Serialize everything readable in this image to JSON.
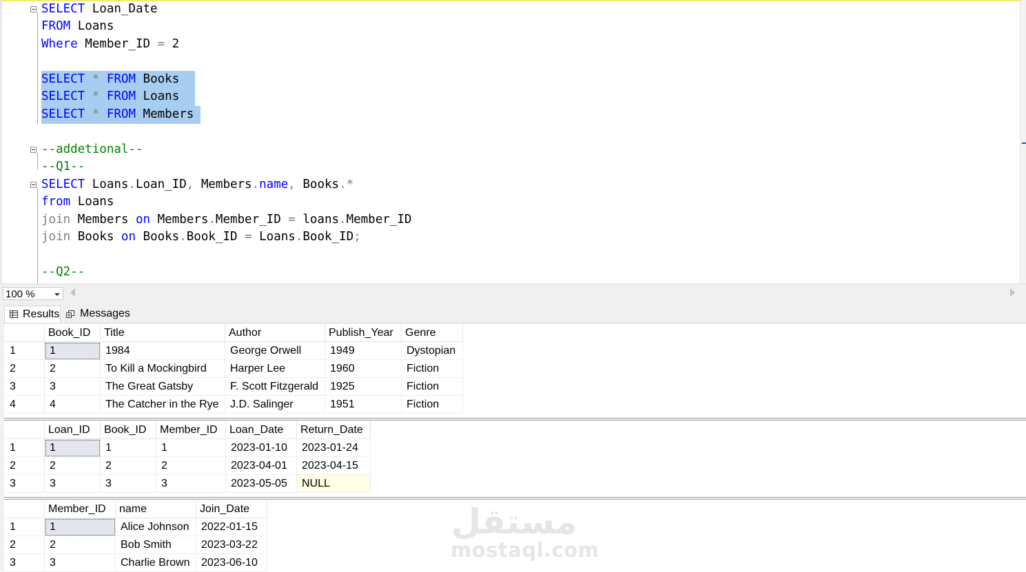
{
  "editor": {
    "lines": [
      {
        "tokens": [
          {
            "t": "SELECT",
            "c": "kw"
          },
          {
            "t": " Loan_Date",
            "c": ""
          }
        ]
      },
      {
        "tokens": [
          {
            "t": "FROM",
            "c": "kw"
          },
          {
            "t": " Loans",
            "c": ""
          }
        ]
      },
      {
        "tokens": [
          {
            "t": "Where",
            "c": "kw"
          },
          {
            "t": " Member_ID ",
            "c": ""
          },
          {
            "t": "=",
            "c": "op"
          },
          {
            "t": " 2",
            "c": ""
          }
        ]
      },
      {
        "tokens": []
      },
      {
        "tokens": [
          {
            "t": "SELECT",
            "c": "kw"
          },
          {
            "t": " ",
            "c": ""
          },
          {
            "t": "*",
            "c": "op"
          },
          {
            "t": " ",
            "c": ""
          },
          {
            "t": "FROM",
            "c": "kw"
          },
          {
            "t": " Books",
            "c": ""
          }
        ]
      },
      {
        "tokens": [
          {
            "t": "SELECT",
            "c": "kw"
          },
          {
            "t": " ",
            "c": ""
          },
          {
            "t": "*",
            "c": "op"
          },
          {
            "t": " ",
            "c": ""
          },
          {
            "t": "FROM",
            "c": "kw"
          },
          {
            "t": " Loans",
            "c": ""
          }
        ]
      },
      {
        "tokens": [
          {
            "t": "SELECT",
            "c": "kw"
          },
          {
            "t": " ",
            "c": ""
          },
          {
            "t": "*",
            "c": "op"
          },
          {
            "t": " ",
            "c": ""
          },
          {
            "t": "FROM",
            "c": "kw"
          },
          {
            "t": " Members",
            "c": ""
          }
        ]
      },
      {
        "tokens": []
      },
      {
        "tokens": [
          {
            "t": "--addetional--",
            "c": "cm"
          }
        ]
      },
      {
        "tokens": [
          {
            "t": "--Q1--",
            "c": "cm"
          }
        ]
      },
      {
        "tokens": [
          {
            "t": "SELECT",
            "c": "kw"
          },
          {
            "t": " Loans",
            "c": ""
          },
          {
            "t": ".",
            "c": "op"
          },
          {
            "t": "Loan_ID",
            "c": ""
          },
          {
            "t": ",",
            "c": "op"
          },
          {
            "t": " Members",
            "c": ""
          },
          {
            "t": ".",
            "c": "op"
          },
          {
            "t": "name",
            "c": "sy"
          },
          {
            "t": ",",
            "c": "op"
          },
          {
            "t": " Books",
            "c": ""
          },
          {
            "t": ".",
            "c": "op"
          },
          {
            "t": "*",
            "c": "op"
          }
        ]
      },
      {
        "tokens": [
          {
            "t": "from",
            "c": "kw"
          },
          {
            "t": " Loans",
            "c": ""
          }
        ]
      },
      {
        "tokens": [
          {
            "t": "join",
            "c": "op"
          },
          {
            "t": " Members ",
            "c": ""
          },
          {
            "t": "on",
            "c": "kw"
          },
          {
            "t": " Members",
            "c": ""
          },
          {
            "t": ".",
            "c": "op"
          },
          {
            "t": "Member_ID ",
            "c": ""
          },
          {
            "t": "=",
            "c": "op"
          },
          {
            "t": " loans",
            "c": ""
          },
          {
            "t": ".",
            "c": "op"
          },
          {
            "t": "Member_ID",
            "c": ""
          }
        ]
      },
      {
        "tokens": [
          {
            "t": "join",
            "c": "op"
          },
          {
            "t": " Books ",
            "c": ""
          },
          {
            "t": "on",
            "c": "kw"
          },
          {
            "t": " Books",
            "c": ""
          },
          {
            "t": ".",
            "c": "op"
          },
          {
            "t": "Book_ID ",
            "c": ""
          },
          {
            "t": "=",
            "c": "op"
          },
          {
            "t": " Loans",
            "c": ""
          },
          {
            "t": ".",
            "c": "op"
          },
          {
            "t": "Book_ID",
            "c": ""
          },
          {
            "t": ";",
            "c": "op"
          }
        ]
      },
      {
        "tokens": []
      },
      {
        "tokens": [
          {
            "t": "--Q2--",
            "c": "cm"
          }
        ]
      }
    ]
  },
  "zoom": {
    "value": "100 %"
  },
  "tabs": {
    "results": "Results",
    "messages": "Messages"
  },
  "grids": [
    {
      "columns": [
        "Book_ID",
        "Title",
        "Author",
        "Publish_Year",
        "Genre"
      ],
      "rows": [
        [
          "1",
          "1",
          "1984",
          "George Orwell",
          "1949",
          "Dystopian"
        ],
        [
          "2",
          "2",
          "To Kill a Mockingbird",
          "Harper Lee",
          "1960",
          "Fiction"
        ],
        [
          "3",
          "3",
          "The Great Gatsby",
          "F. Scott Fitzgerald",
          "1925",
          "Fiction"
        ],
        [
          "4",
          "4",
          "The Catcher in the Rye",
          "J.D. Salinger",
          "1951",
          "Fiction"
        ]
      ]
    },
    {
      "columns": [
        "Loan_ID",
        "Book_ID",
        "Member_ID",
        "Loan_Date",
        "Return_Date"
      ],
      "rows": [
        [
          "1",
          "1",
          "1",
          "1",
          "2023-01-10",
          "2023-01-24"
        ],
        [
          "2",
          "2",
          "2",
          "2",
          "2023-04-01",
          "2023-04-15"
        ],
        [
          "3",
          "3",
          "3",
          "3",
          "2023-05-05",
          "NULL"
        ]
      ]
    },
    {
      "columns": [
        "Member_ID",
        "name",
        "Join_Date"
      ],
      "rows": [
        [
          "1",
          "1",
          "Alice Johnson",
          "2022-01-15"
        ],
        [
          "2",
          "2",
          "Bob Smith",
          "2023-03-22"
        ],
        [
          "3",
          "3",
          "Charlie Brown",
          "2023-06-10"
        ]
      ]
    }
  ],
  "watermark": {
    "arabic": "مستقل",
    "latin": "mostaql.com"
  }
}
